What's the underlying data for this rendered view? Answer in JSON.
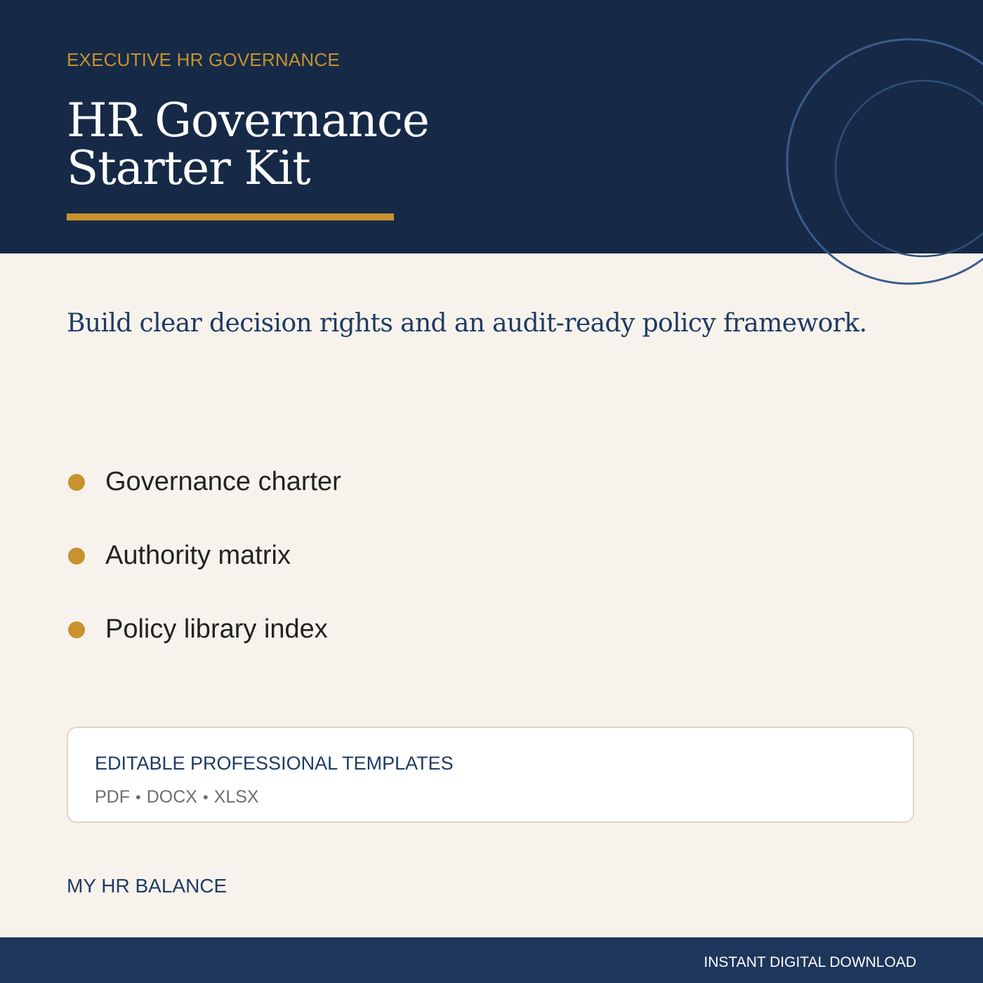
{
  "header": {
    "eyebrow": "EXECUTIVE HR GOVERNANCE",
    "title_line1": "HR Governance",
    "title_line2": "Starter Kit"
  },
  "subtitle": "Build clear decision rights and an audit-ready policy framework.",
  "features": [
    {
      "label": "Governance charter"
    },
    {
      "label": "Authority matrix"
    },
    {
      "label": "Policy library index"
    }
  ],
  "card": {
    "title": "EDITABLE PROFESSIONAL TEMPLATES",
    "formats": [
      "PDF",
      "DOCX",
      "XLSX"
    ],
    "separator": "•"
  },
  "brand": "MY HR BALANCE",
  "footer": {
    "text": "INSTANT DIGITAL DOWNLOAD"
  },
  "colors": {
    "navy": "#162A47",
    "footer_navy": "#1E365C",
    "gold": "#C8922E",
    "cream": "#F7F3EC",
    "ring": "#3A5C8C"
  }
}
